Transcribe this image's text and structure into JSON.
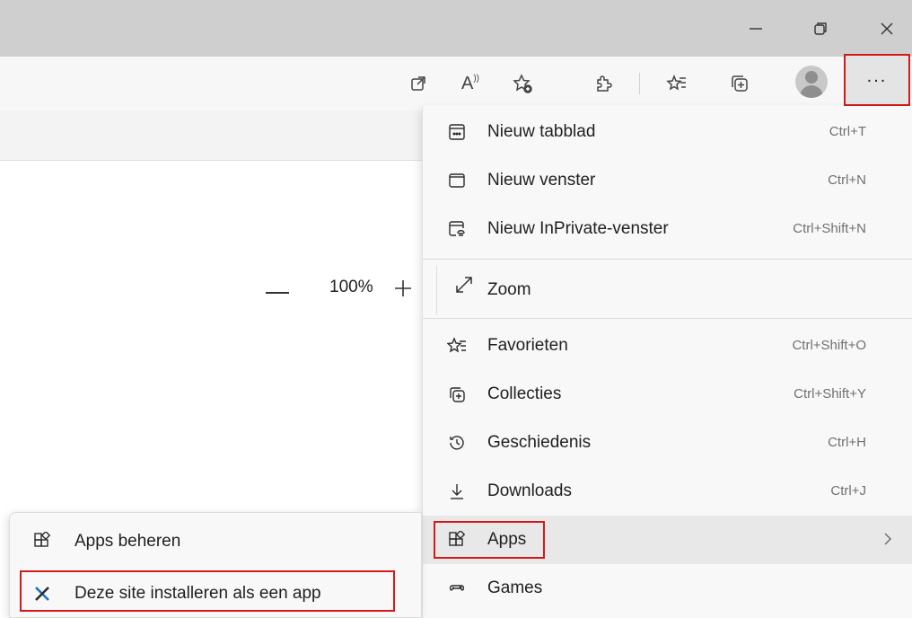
{
  "window_controls": {
    "minimize_icon": "minimize-icon",
    "restore_icon": "restore-icon",
    "close_icon": "close-icon"
  },
  "toolbar": {
    "icons": [
      "open-in-app-icon",
      "read-aloud-icon",
      "add-favorite-icon",
      "extensions-icon",
      "favorites-icon",
      "collections-icon",
      "profile-avatar",
      "more-icon"
    ],
    "read_aloud_text": "A",
    "more_label": "..."
  },
  "menu": {
    "new_tab": {
      "label": "Nieuw tabblad",
      "shortcut": "Ctrl+T"
    },
    "new_window": {
      "label": "Nieuw venster",
      "shortcut": "Ctrl+N"
    },
    "inprivate": {
      "label": "Nieuw InPrivate-venster",
      "shortcut": "Ctrl+Shift+N"
    },
    "zoom": {
      "label": "Zoom",
      "value": "100%"
    },
    "favorites": {
      "label": "Favorieten",
      "shortcut": "Ctrl+Shift+O"
    },
    "collections": {
      "label": "Collecties",
      "shortcut": "Ctrl+Shift+Y"
    },
    "history": {
      "label": "Geschiedenis",
      "shortcut": "Ctrl+H"
    },
    "downloads": {
      "label": "Downloads",
      "shortcut": "Ctrl+J"
    },
    "apps": {
      "label": "Apps"
    },
    "games": {
      "label": "Games"
    }
  },
  "submenu": {
    "manage_apps": {
      "label": "Apps beheren"
    },
    "install_site": {
      "label": "Deze site installeren als een app"
    }
  },
  "colors": {
    "highlight_border": "#d11a1a",
    "titlebar_bg": "#cfcfcf",
    "menu_bg": "#f8f8f8"
  }
}
